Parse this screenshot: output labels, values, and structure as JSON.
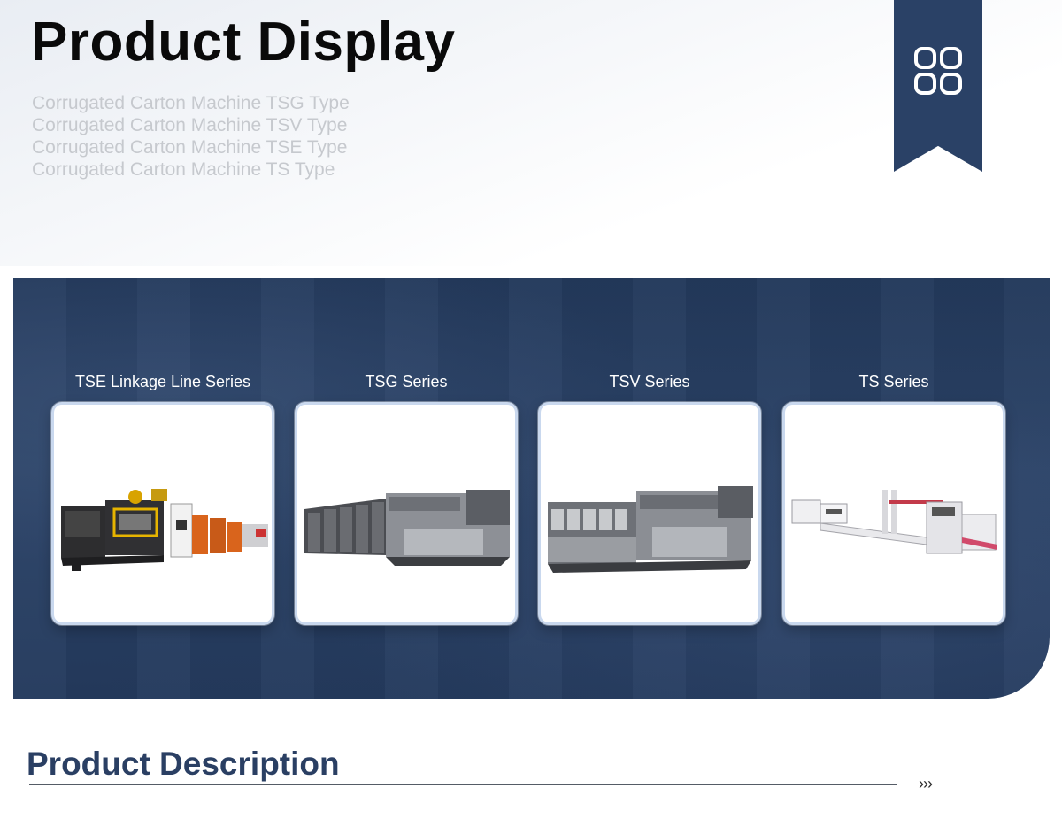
{
  "header": {
    "title": "Product Display",
    "subtitles": [
      "Corrugated Carton Machine TSG Type",
      "Corrugated Carton Machine TSV Type",
      "Corrugated Carton Machine TSE Type",
      "Corrugated Carton Machine TS Type"
    ]
  },
  "ribbon": {
    "icon": "grid-icon",
    "color": "#2a4166"
  },
  "products": [
    {
      "label": "TSE Linkage Line Series",
      "image": "tse-linkage-line-machine"
    },
    {
      "label": "TSG Series",
      "image": "tsg-machine"
    },
    {
      "label": "TSV Series",
      "image": "tsv-machine"
    },
    {
      "label": "TS Series",
      "image": "ts-machine"
    }
  ],
  "description": {
    "title": "Product Description",
    "arrows": "›››"
  },
  "colors": {
    "band": "#2a4266",
    "accent_title": "#2a3f63",
    "subtitle_gray": "#c6c9ce"
  }
}
